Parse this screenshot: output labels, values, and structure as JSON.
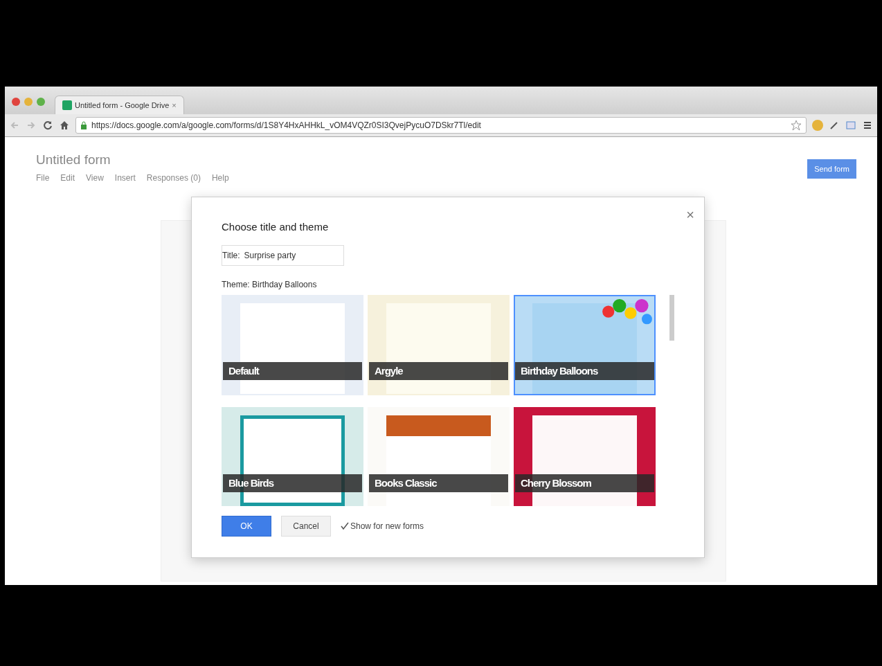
{
  "browser": {
    "tab_title": "Untitled form - Google Drive",
    "tab_close": "×",
    "url": "https://docs.google.com/a/google.com/forms/d/1S8Y4HxAHHkL_vOM4VQZr0SI3QvejPycuO7DSkr7Tl/edit"
  },
  "page": {
    "title": "Untitled form",
    "menus": [
      "File",
      "Edit",
      "View",
      "Insert",
      "Responses (0)",
      "Help"
    ],
    "send_button": "Send form"
  },
  "dialog": {
    "title": "Choose title and theme",
    "close": "×",
    "title_label": "Title:",
    "title_value": "Surprise party",
    "theme_label": "Theme: Birthday Balloons",
    "themes": [
      {
        "name": "Default",
        "kind": "default",
        "selected": false
      },
      {
        "name": "Argyle",
        "kind": "argyle",
        "selected": false
      },
      {
        "name": "Birthday Balloons",
        "kind": "balloons",
        "selected": true
      },
      {
        "name": "Blue Birds",
        "kind": "birds",
        "selected": false
      },
      {
        "name": "Books Classic",
        "kind": "books",
        "selected": false
      },
      {
        "name": "Cherry Blossom",
        "kind": "cherry",
        "selected": false
      }
    ],
    "ok": "OK",
    "cancel": "Cancel",
    "show_checkbox": {
      "label": "Show for new forms",
      "checked": true
    }
  }
}
